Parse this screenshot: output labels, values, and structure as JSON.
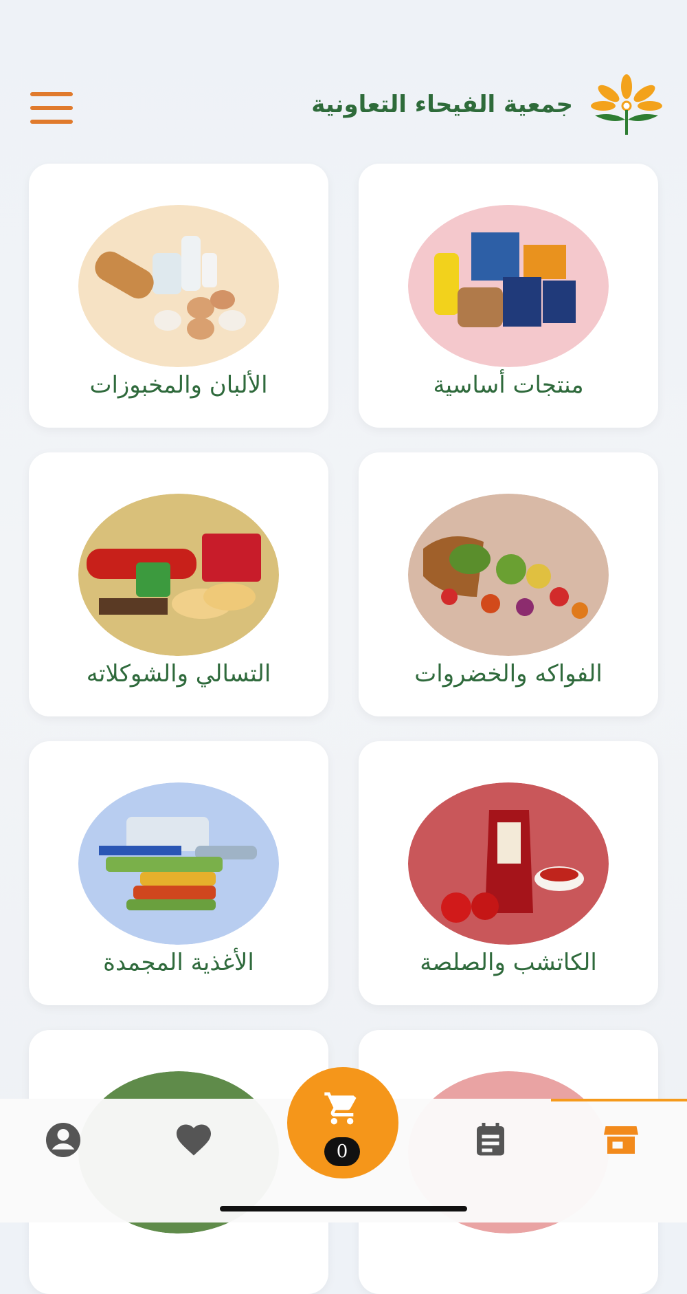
{
  "header": {
    "brand_name": "جمعية الفيحاء التعاونية",
    "logo_icon": "flower-logo-icon",
    "menu_icon": "hamburger-menu-icon"
  },
  "categories": [
    {
      "label": "منتجات أساسية",
      "image": "staples-photo",
      "bg": "#f4c8cc"
    },
    {
      "label": "الألبان والمخبوزات",
      "image": "dairy-bakery-photo",
      "bg": "#f6e2c4"
    },
    {
      "label": "الفواكه والخضروات",
      "image": "fruits-vegetables-photo",
      "bg": "#d8b9a6"
    },
    {
      "label": "التسالي والشوكلاته",
      "image": "snacks-chocolate-photo",
      "bg": "#d9c07a"
    },
    {
      "label": "الكاتشب والصلصة",
      "image": "ketchup-sauce-photo",
      "bg": "#c9575a"
    },
    {
      "label": "الأغذية المجمدة",
      "image": "frozen-food-photo",
      "bg": "#b8cdf0"
    },
    {
      "label": "",
      "image": "category-photo-7",
      "bg": "#e9a3a3"
    },
    {
      "label": "",
      "image": "category-photo-8",
      "bg": "#5f8b4a"
    }
  ],
  "nav": {
    "items": [
      {
        "name": "store-icon",
        "active": true
      },
      {
        "name": "orders-icon",
        "active": false
      },
      {
        "name": "favorites-icon",
        "active": false
      },
      {
        "name": "profile-icon",
        "active": false
      }
    ],
    "cart_count": "0",
    "accent": "#f5961a",
    "active_color": "#f28a1c",
    "inactive_color": "#555555"
  }
}
